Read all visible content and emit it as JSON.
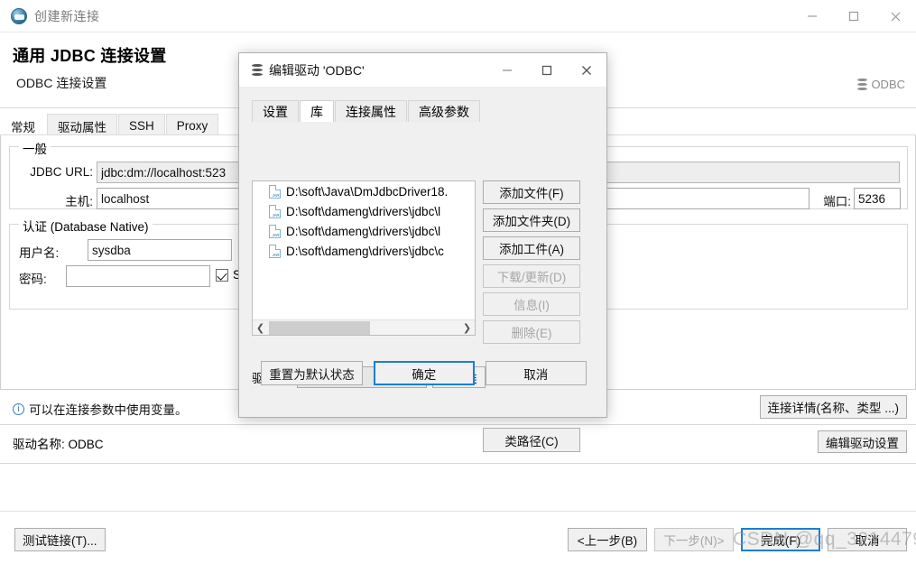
{
  "window": {
    "title": "创建新连接",
    "icon": "connection-icon",
    "controls": {
      "minimize": "—",
      "maximize": "☐",
      "close": "✕"
    }
  },
  "header": {
    "title": "通用 JDBC 连接设置",
    "subtitle": "ODBC 连接设置",
    "brand": "ODBC"
  },
  "main_tabs": [
    {
      "label": "常规",
      "active": true
    },
    {
      "label": "驱动属性",
      "active": false
    },
    {
      "label": "SSH",
      "active": false
    },
    {
      "label": "Proxy",
      "active": false
    }
  ],
  "general_group": {
    "legend": "一般",
    "jdbc_url_label": "JDBC URL:",
    "jdbc_url_value": "jdbc:dm://localhost:523",
    "host_label": "主机:",
    "host_value": "localhost",
    "port_label": "端口:",
    "port_value": "5236"
  },
  "auth_group": {
    "legend": "认证 (Database Native)",
    "username_label": "用户名:",
    "username_value": "sysdba",
    "password_label": "密码:",
    "password_value": "",
    "save_checkbox_label": "Sa",
    "save_checked": true
  },
  "footer_info": {
    "icon": "info-icon",
    "text": "可以在连接参数中使用变量。",
    "connection_details_button": "连接详情(名称、类型 ...)",
    "driver_name_label": "驱动名称: ODBC",
    "edit_driver_button": "编辑驱动设置"
  },
  "bottom_bar": {
    "test_button": "测试链接(T)...",
    "back_button": "<上一步(B)",
    "next_button": "下一步(N)>",
    "finish_button": "完成(F)",
    "cancel_button": "取消"
  },
  "watermark": "CSDN @qq_32144799",
  "dialog": {
    "title": "编辑驱动 'ODBC'",
    "icon": "database-icon",
    "controls": {
      "minimize": "—",
      "maximize": "☐",
      "close": "✕"
    },
    "tabs": [
      {
        "label": "设置",
        "active": false
      },
      {
        "label": "库",
        "active": true
      },
      {
        "label": "连接属性",
        "active": false
      },
      {
        "label": "高级参数",
        "active": false
      }
    ],
    "library_list": [
      {
        "icon": "jar-file-icon",
        "path": "D:\\soft\\Java\\DmJdbcDriver18."
      },
      {
        "icon": "jar-file-icon",
        "path": "D:\\soft\\dameng\\drivers\\jdbc\\l"
      },
      {
        "icon": "jar-file-icon",
        "path": "D:\\soft\\dameng\\drivers\\jdbc\\l"
      },
      {
        "icon": "jar-file-icon",
        "path": "D:\\soft\\dameng\\drivers\\jdbc\\c"
      }
    ],
    "side_buttons": [
      {
        "label": "添加文件(F)",
        "disabled": false
      },
      {
        "label": "添加文件夹(D)",
        "disabled": false
      },
      {
        "label": "添加工件(A)",
        "disabled": false
      },
      {
        "label": "下载/更新(D)",
        "disabled": true
      },
      {
        "label": "信息(I)",
        "disabled": true
      },
      {
        "label": "删除(E)",
        "disabled": true
      }
    ],
    "classpath_button": "类路径(C)",
    "driver_class_label": "驱动类:",
    "driver_class_value": "",
    "find_class_button": "找到类",
    "footer": {
      "reset_button": "重置为默认状态",
      "ok_button": "确定",
      "cancel_button": "取消"
    }
  }
}
